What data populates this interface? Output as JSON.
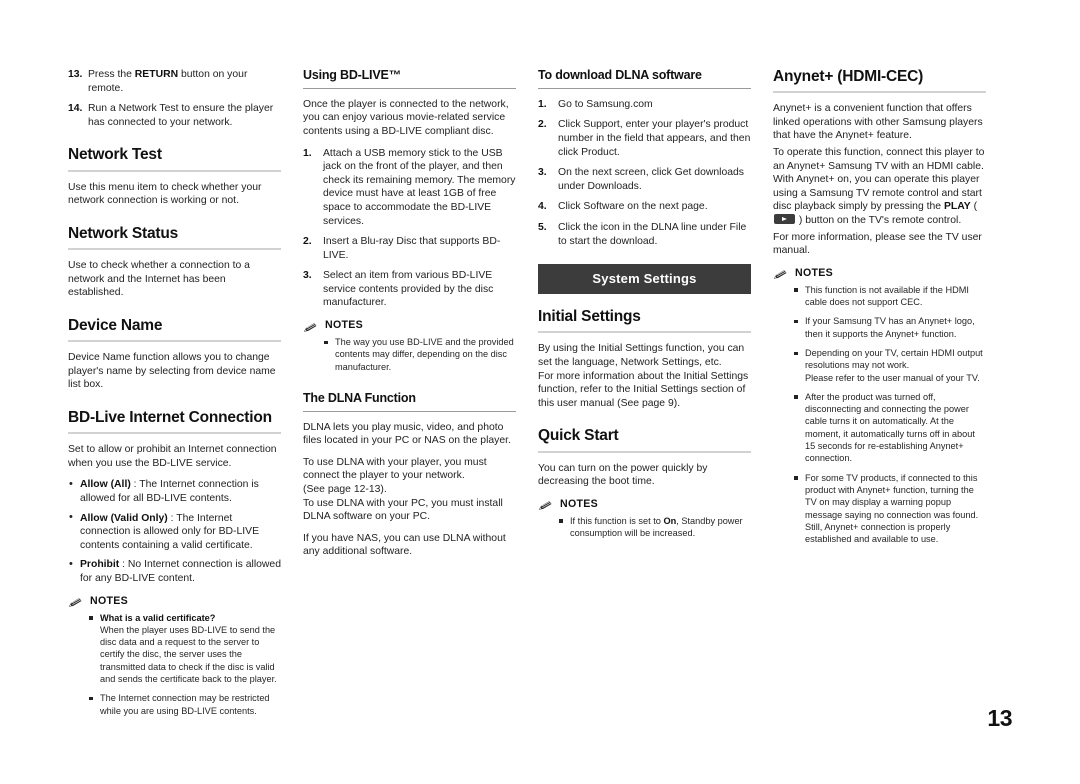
{
  "page": {
    "number": "13",
    "banner_color": "#3c3c3c",
    "rule_color": "#d2d2d2"
  },
  "notes_label": "NOTES",
  "col1": {
    "steps": [
      {
        "num": "13.",
        "text_before": "Press the ",
        "bold": "RETURN",
        "text_after": " button on your remote."
      },
      {
        "num": "14.",
        "text_before": "Run a Network Test to ensure the player has connected to your network.",
        "bold": "",
        "text_after": ""
      }
    ],
    "network_test": {
      "heading": "Network Test",
      "body": "Use this menu item to check whether your network connection is working or not."
    },
    "network_status": {
      "heading": "Network Status",
      "body": "Use to check whether a connection to a network and the Internet has been established."
    },
    "device_name": {
      "heading": "Device Name",
      "body": "Device Name function allows you to change player's name by selecting from device name list box."
    },
    "bdlive": {
      "heading": "BD-Live Internet Connection",
      "body": "Set to allow or prohibit an Internet connection when you use the BD-LIVE service.",
      "bullets": [
        {
          "bold": "Allow (All)",
          "rest": " : The Internet connection is allowed for all BD-LIVE contents."
        },
        {
          "bold": "Allow (Valid Only)",
          "rest": " : The Internet connection is allowed only for BD-LIVE contents containing a valid certificate."
        },
        {
          "bold": "Prohibit",
          "rest": " : No Internet connection is allowed for any BD-LIVE content."
        }
      ],
      "notes": [
        {
          "title": "What is a valid certificate?",
          "text": "When the player uses BD-LIVE to send the disc data and a request to the server to certify the disc, the server uses the transmitted data to check if the disc is valid and sends the certificate back to the player."
        },
        {
          "title": "",
          "text": "The Internet connection may be restricted while you are using BD-LIVE contents."
        }
      ]
    }
  },
  "col2": {
    "using_bdlive": {
      "heading": "Using BD-LIVE™",
      "body": "Once the player is connected to the network, you can enjoy various movie-related service contents using a BD-LIVE compliant disc.",
      "steps": [
        {
          "num": "1.",
          "text": "Attach a USB memory stick to the USB jack on the front of the player, and then check its remaining memory. The memory device must have at least 1GB of free space to accommodate the BD-LIVE services."
        },
        {
          "num": "2.",
          "text": "Insert a Blu-ray Disc that supports BD-LIVE."
        },
        {
          "num": "3.",
          "text": "Select an item from various BD-LIVE service contents provided by the disc manufacturer."
        }
      ],
      "notes": [
        {
          "title": "",
          "text": "The way you use BD-LIVE and the provided contents may differ, depending on the disc manufacturer."
        }
      ]
    },
    "dlna": {
      "heading": "The DLNA Function",
      "paragraphs": [
        "DLNA lets you play music, video, and photo files located in your PC or NAS on the player.",
        "To use DLNA with your player, you must connect the player to your network.\n(See page 12-13).\nTo use DLNA with your PC, you must install DLNA software on your PC.",
        "If you have NAS, you can use DLNA without any additional software."
      ]
    }
  },
  "col3": {
    "download_dlna": {
      "heading": "To download DLNA software",
      "steps": [
        {
          "num": "1.",
          "text": "Go to Samsung.com"
        },
        {
          "num": "2.",
          "text": "Click Support, enter your player's product number in the field that appears, and then click Product."
        },
        {
          "num": "3.",
          "text": "On the next screen, click Get downloads under Downloads."
        },
        {
          "num": "4.",
          "text": "Click Software on the next page."
        },
        {
          "num": "5.",
          "text": "Click the icon in the DLNA line under File to start the download."
        }
      ]
    },
    "banner": "System Settings",
    "initial_settings": {
      "heading": "Initial Settings",
      "body": "By using the Initial Settings function, you can set the language, Network Settings, etc.\nFor more information about the Initial Settings function, refer to the Initial Settings section of this user manual (See page 9)."
    },
    "quick_start": {
      "heading": "Quick Start",
      "body": "You can turn on the power quickly by decreasing the boot time.",
      "notes": [
        {
          "before": "If this function is set to ",
          "bold": "On",
          "after": ", Standby power consumption will be increased."
        }
      ]
    }
  },
  "col4": {
    "anynet": {
      "heading": "Anynet+ (HDMI-CEC)",
      "para1": "Anynet+ is a convenient function that offers linked operations with other Samsung players that have the Anynet+ feature.",
      "para2_a": "To operate this function, connect this player to an Anynet+ Samsung TV with an HDMI cable. With Anynet+ on, you can operate this player using a Samsung TV remote control and start disc playback simply by pressing the ",
      "para2_bold": "PLAY",
      "para2_b": " ( ",
      "para2_c": " ) button on the TV's remote control.",
      "para3": "For more information, please see the TV user manual.",
      "notes": [
        {
          "text": "This function is not available if the HDMI cable does not support CEC."
        },
        {
          "text": "If your Samsung TV has an Anynet+ logo, then it supports the Anynet+ function."
        },
        {
          "text": "Depending on your TV, certain HDMI output resolutions may not work.\nPlease refer to the user manual of your TV."
        },
        {
          "text": "After the product was turned off, disconnecting and connecting the power cable turns it on automatically. At the moment, it automatically turns off in about 15 seconds for re-establishing Anynet+ connection."
        },
        {
          "text": "For some TV products, if connected to this product with Anynet+ function, turning the TV on may display a warning popup message saying no connection was found. Still, Anynet+ connection is properly established and available to use."
        }
      ]
    }
  }
}
